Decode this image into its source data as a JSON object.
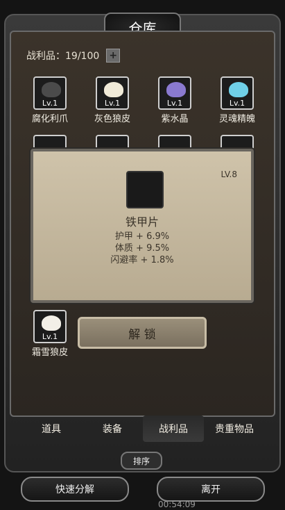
{
  "title": "仓库",
  "loot": {
    "label": "战利品：19/100",
    "plus": "+"
  },
  "items": [
    {
      "name": "腐化利爪",
      "level": "Lv.1",
      "color": "#4b4b4b"
    },
    {
      "name": "灰色狼皮",
      "level": "Lv.1",
      "color": "#f0ead8"
    },
    {
      "name": "紫水晶",
      "level": "Lv.1",
      "color": "#8a7ad0"
    },
    {
      "name": "灵魂精魄",
      "level": "Lv.1",
      "color": "#6fd0e8"
    },
    {
      "name": "霜雪狼皮",
      "level": "Lv.1",
      "color": "#f2efe7"
    }
  ],
  "popup": {
    "level": "LV.8",
    "name": "铁甲片",
    "stats": [
      "护甲 + 6.9%",
      "体质 + 9.5%",
      "闪避率 + 1.8%"
    ]
  },
  "unlock_label": "解 锁",
  "tabs": [
    "道具",
    "装备",
    "战利品",
    "贵重物品"
  ],
  "active_tab": "战利品",
  "sort_label": "排序",
  "actions": {
    "quick": "快速分解",
    "leave": "离开"
  },
  "timer": "00:54:09"
}
